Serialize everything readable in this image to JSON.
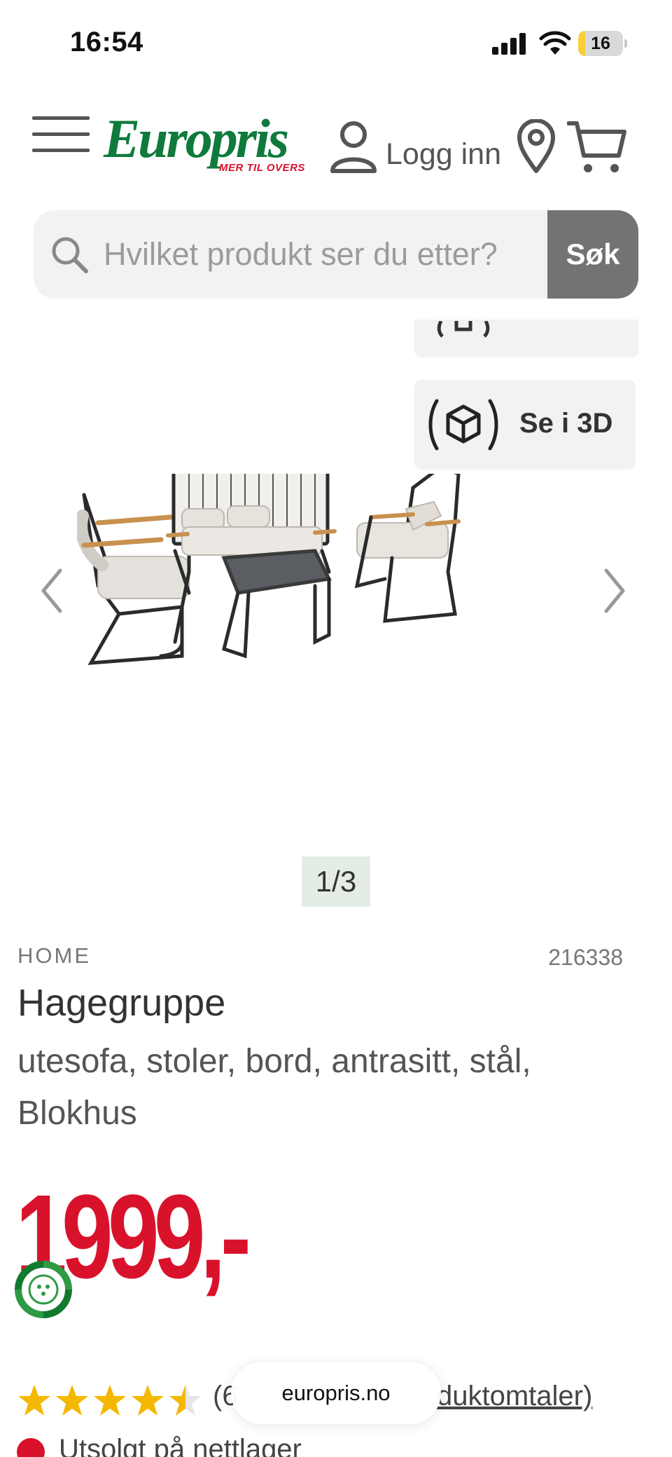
{
  "status_bar": {
    "time": "16:54",
    "battery_percent": "16",
    "battery_level": 0.16,
    "battery_color": "#f7d038"
  },
  "header": {
    "logo": "Europris",
    "logo_tagline": "MER TIL OVERS",
    "login_label": "Logg inn",
    "icons": [
      "menu-icon",
      "user-icon",
      "location-pin-icon",
      "cart-icon"
    ],
    "brand_green": "#0f7a3c",
    "brand_red": "#d9122c"
  },
  "search": {
    "placeholder": "Hvilket produkt ser du etter?",
    "button_label": "Søk"
  },
  "gallery": {
    "view_3d_label": "Se i 3D",
    "counter": "1/3",
    "prev_icon": "chevron-left-icon",
    "next_icon": "chevron-right-icon"
  },
  "product": {
    "brand": "HOME",
    "sku": "216338",
    "title": "Hagegruppe",
    "subtitle": "utesofa, stoler, bord, antrasitt, stål, Blokhus",
    "price": "1999,-",
    "rating_stars": 4.5,
    "rating_count_text": "(6",
    "reviews_link": "duktomtaler)",
    "stock_text": "Utsolgt på nettlager"
  },
  "browser": {
    "url": "europris.no"
  }
}
